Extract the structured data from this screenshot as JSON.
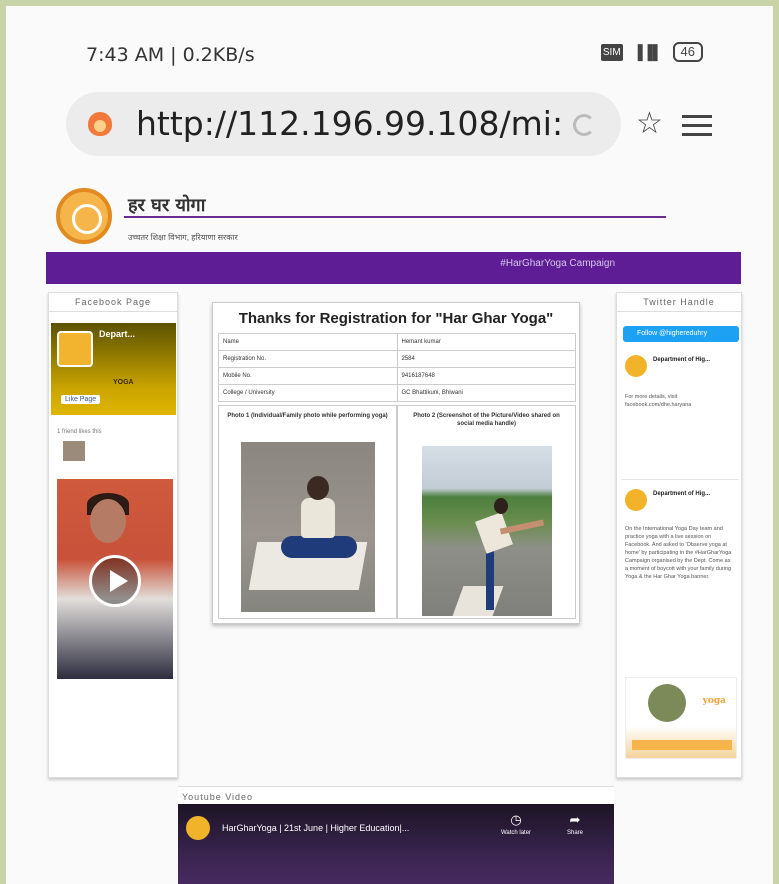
{
  "status_bar": {
    "time": "7:43 AM | 0.2KB/s",
    "signal": "▐▐▌",
    "battery": "46",
    "sim": "SIM"
  },
  "browser": {
    "url": "http://112.196.99.108/mi:"
  },
  "site": {
    "title": "हर घर योगा",
    "subtitle": "उच्चतर शिक्षा विभाग, हरियाणा सरकार",
    "campaign": "#HarGharYoga Campaign"
  },
  "facebook": {
    "heading": "Facebook Page",
    "page_name": "Depart...",
    "cover_text": "YOGA",
    "like_label": "Like Page",
    "followers": "1 friend likes this"
  },
  "registration": {
    "heading": "Thanks for Registration for \"Har Ghar Yoga\"",
    "rows": [
      {
        "label": "Name",
        "value": "Hemant kumar"
      },
      {
        "label": "Registration No.",
        "value": "2584"
      },
      {
        "label": "Mobile No.",
        "value": "9416187648"
      },
      {
        "label": "College / University",
        "value": "GC Bhattikuni, Bhiwani"
      }
    ],
    "photo1_caption": "Photo 1 (Individual/Family photo while performing yoga)",
    "photo2_caption": "Photo 2 (Screenshot of the Picture/Video shared on social media handle)"
  },
  "twitter": {
    "heading": "Twitter Handle",
    "follow_label": "Follow @highereduhry",
    "tweet1_name": "Department of Hig...",
    "tweet1_text": "For more details, visit facebook.com/dhe.haryana",
    "tweet2_name": "Department of Hig...",
    "tweet2_text": "On the International Yoga Day team and practice yoga with a live session on Facebook. And asked to 'Observe yoga at home' by participating in the #HarGharYoga Campaign organised by the Dept. Come as a moment of boycott with your family during Yoga & the Har Ghar Yoga banner.",
    "brand": "yoga"
  },
  "youtube": {
    "heading": "Youtube Video",
    "video_title": "HarGharYoga | 21st June | Higher Education|...",
    "watch_later": "Watch later",
    "share": "Share"
  }
}
